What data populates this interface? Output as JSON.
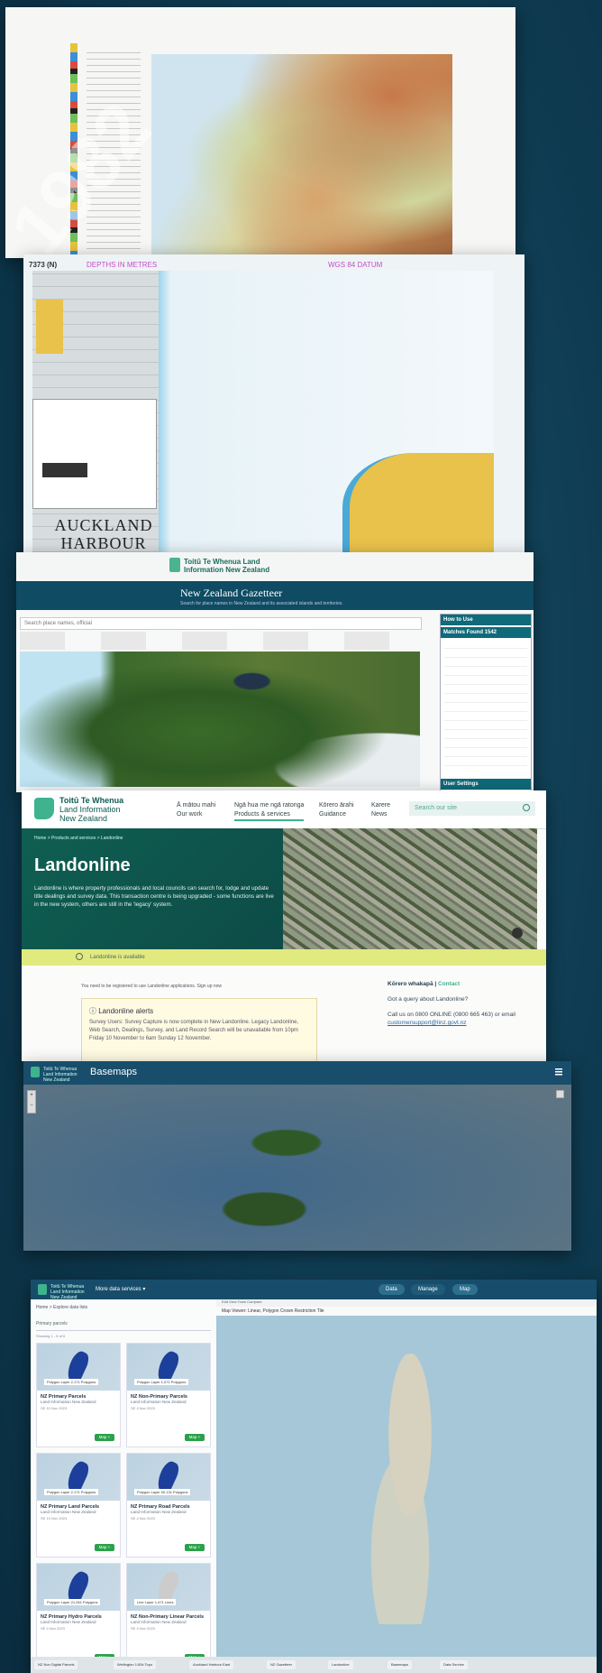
{
  "watermark": "1982",
  "topo": {},
  "nautical": {
    "code": "7373 (N)",
    "depth_units": "DEPTHS IN METRES",
    "datum": "WGS 84 DATUM",
    "title": "AUCKLAND HARBOUR EAST"
  },
  "gazetteer": {
    "org": "Toitū Te Whenua Land Information New Zealand",
    "title": "New Zealand Gazetteer",
    "subtitle": "Search for place names in New Zealand and its associated islands and territories.",
    "search_placeholder": "Search place names, official",
    "side_header_1": "How to Use",
    "side_header_2": "Matches Found 1542",
    "side_header_3": "User Settings"
  },
  "landonline": {
    "org_line1": "Toitū Te Whenua",
    "org_line2": "Land Information",
    "org_line3": "New Zealand",
    "menu": [
      {
        "mi": "Ā mātou mahi",
        "en": "Our work"
      },
      {
        "mi": "Ngā hua me ngā ratonga",
        "en": "Products & services"
      },
      {
        "mi": "Kōrero ārahi",
        "en": "Guidance"
      },
      {
        "mi": "Karere",
        "en": "News"
      }
    ],
    "search_placeholder": "Search our site",
    "breadcrumb": "Home  >  Products and services  >  Landonline",
    "heading": "Landonline",
    "intro": "Landonline is where property professionals and local councils can search for, lodge and update title dealings and survey data. This transaction centre is being upgraded - some functions are live in the new system, others are still in the 'legacy' system.",
    "banner": "Landonline is available",
    "reg_note": "You need to be registered to use Landonline applications. Sign up now",
    "alert_title": "Landonline alerts",
    "alert_body": "Survey Users: Survey Capture is now complete in New Landonline. Legacy Landonline, Web Search, Dealings, Survey, and Land Record Search will be unavailable from 10pm Friday 10 November to 6am Sunday 12 November.",
    "contact_mi": "Kōrero whakapā",
    "contact_en": "Contact",
    "contact_q": "Got a query about Landonline?",
    "contact_call": "Call us on 0800 ONLINE (0800 665 463) or email",
    "contact_email": "customersupport@linz.govt.nz"
  },
  "basemaps": {
    "org": "Toitū Te Whenua Land Information New Zealand",
    "title": "Basemaps",
    "zoom_in": "+",
    "zoom_out": "−"
  },
  "dataservice": {
    "org": "Toitū Te Whenua Land Information New Zealand",
    "more": "More data services ▾",
    "btn_data": "Data",
    "btn_manage": "Manage",
    "btn_map": "Map",
    "crumbs": "Home  >  Explore data lists",
    "filter": "Primary parcels",
    "showing": "Showing 1 - 6 of 6",
    "map_tabs": "Edit   View   Tools   Compare",
    "map_title": "Map Viewer: Linear, Polygon Crown Restriction Tile",
    "cards": [
      {
        "name": "NZ Primary Parcels",
        "org": "Land Information New Zealand",
        "label": "Polygon Layer 2,171 Polygons",
        "meta": "SE 10 Nov 2023",
        "btn": "Map +"
      },
      {
        "name": "NZ Non-Primary Parcels",
        "org": "Land Information New Zealand",
        "label": "Polygon Layer 1,071 Polygons",
        "meta": "SE 4 Nov 2023",
        "btn": "Map +"
      },
      {
        "name": "NZ Primary Land Parcels",
        "org": "Land Information New Zealand",
        "label": "Polygon Layer 2,171 Polygons",
        "meta": "SE 10 Nov 2023",
        "btn": "Map +"
      },
      {
        "name": "NZ Primary Road Parcels",
        "org": "Land Information New Zealand",
        "label": "Polygon Layer 90,131 Polygons",
        "meta": "SE 4 Nov 2023",
        "btn": "Map +"
      },
      {
        "name": "NZ Primary Hydro Parcels",
        "org": "Land Information New Zealand",
        "label": "Polygon Layer 21,061 Polygons",
        "meta": "SE 4 Nov 2023",
        "btn": "Map +"
      },
      {
        "name": "NZ Non-Primary Linear Parcels",
        "org": "Land Information New Zealand",
        "label": "Line Layer 1,471 Lines",
        "meta": "SE 4 Nov 2023",
        "btn": "Map +"
      }
    ],
    "taskbar": [
      "NZ Non Digital Parcels",
      "Wellington 1:50k Topo",
      "Auckland Harbour East",
      "NZ Gazetteer",
      "Landonline",
      "Basemaps",
      "Data Service"
    ]
  }
}
